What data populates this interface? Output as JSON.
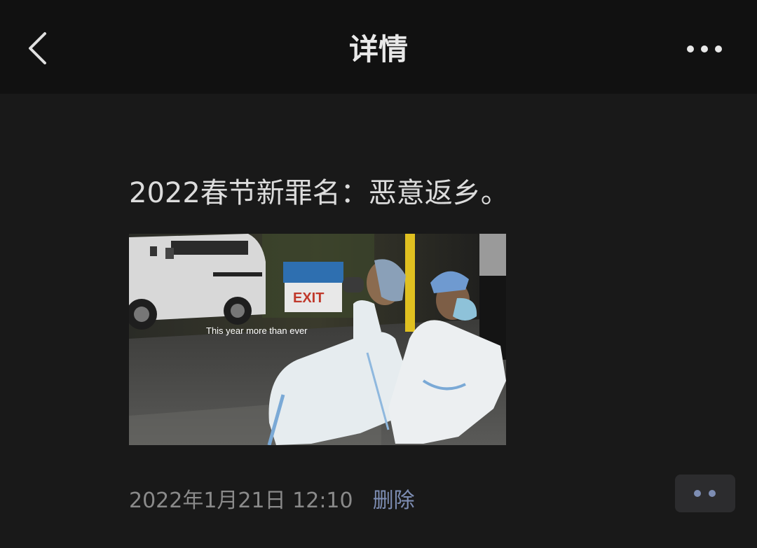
{
  "header": {
    "title": "详情",
    "back_icon": "chevron-left-icon",
    "more_icon": "more-horizontal-icon"
  },
  "post": {
    "text": "2022春节新罪名：恶意返乡。",
    "image": {
      "caption": "This year more than ever",
      "sign_text": "EXIT"
    },
    "timestamp": "2022年1月21日 12:10",
    "delete_label": "删除",
    "comment_icon": "comment-dots-icon"
  },
  "colors": {
    "header_bg": "#111111",
    "page_bg": "#191919",
    "link": "#7d8db3",
    "comment_btn_bg": "#2c2c2e"
  }
}
